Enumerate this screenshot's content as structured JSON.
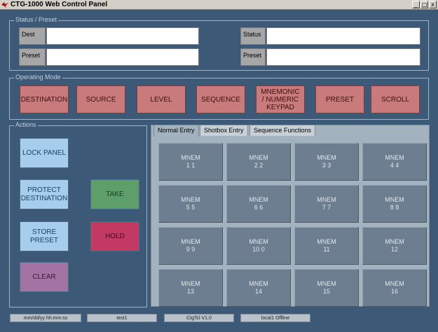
{
  "window": {
    "title": "CTG-1000 Web Control Panel",
    "min": "_",
    "max": "□",
    "close": "x"
  },
  "status_group": {
    "title": "Status / Preset",
    "dest_label": "Dest",
    "dest_value": "",
    "preset_left_label": "Preset",
    "preset_left_value": "",
    "status_label": "Status",
    "status_value": "",
    "preset_right_label": "Preset",
    "preset_right_value": ""
  },
  "operating_mode": {
    "title": "Operating Mode",
    "buttons": [
      "DESTINATION",
      "SOURCE",
      "LEVEL",
      "SEQUENCE",
      "MNEMONIC / NUMERIC KEYPAD",
      "PRESET",
      "SCROLL"
    ]
  },
  "actions": {
    "title": "Actions",
    "lock_panel": "LOCK PANEL",
    "protect_destination": "PROTECT DESTINATION",
    "store_preset": "STORE PRESET",
    "clear": "CLEAR",
    "take": "TAKE",
    "hold": "HOLD"
  },
  "tabs": [
    "Normal Entry",
    "Shotbox Entry",
    "Sequence Functions"
  ],
  "mnemonics": [
    {
      "name": "MNEM",
      "num": "1 1"
    },
    {
      "name": "MNEM",
      "num": "2 2"
    },
    {
      "name": "MNEM",
      "num": "3 3"
    },
    {
      "name": "MNEM",
      "num": "4 4"
    },
    {
      "name": "MNEM",
      "num": "5 5"
    },
    {
      "name": "MNEM",
      "num": "6 6"
    },
    {
      "name": "MNEM",
      "num": "7 7"
    },
    {
      "name": "MNEM",
      "num": "8 8"
    },
    {
      "name": "MNEM",
      "num": "9 9"
    },
    {
      "name": "MNEM",
      "num": "10 0"
    },
    {
      "name": "MNEM",
      "num": "11"
    },
    {
      "name": "MNEM",
      "num": "12"
    },
    {
      "name": "MNEM",
      "num": "13"
    },
    {
      "name": "MNEM",
      "num": "14"
    },
    {
      "name": "MNEM",
      "num": "15"
    },
    {
      "name": "MNEM",
      "num": "16"
    }
  ],
  "statusbar": [
    "mm/dd/yy hh:mm:ss",
    "test1",
    "CtgTcl V1.0",
    "local1 Offline"
  ],
  "colors": {
    "background": "#3c5a78",
    "mode_button": "#c97a7a",
    "take": "#5e9e6a",
    "hold": "#c23a63",
    "action_blue": "#a6cdec",
    "clear": "#a273a3",
    "mnem_button": "#6c7e8f"
  }
}
